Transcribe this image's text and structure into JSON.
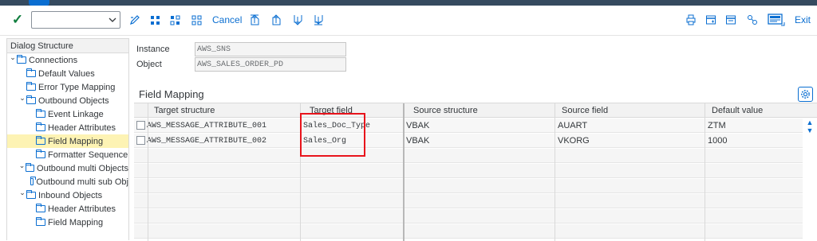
{
  "toolbar": {
    "command_value": "",
    "cancel_label": "Cancel",
    "exit_label": "Exit"
  },
  "dialog": {
    "title": "Dialog Structure",
    "items": [
      {
        "label": "Connections",
        "level": 0,
        "caret": true,
        "selected": false
      },
      {
        "label": "Default Values",
        "level": 1,
        "caret": false,
        "selected": false
      },
      {
        "label": "Error Type Mapping",
        "level": 1,
        "caret": false,
        "selected": false
      },
      {
        "label": "Outbound  Objects",
        "level": 1,
        "caret": true,
        "selected": false
      },
      {
        "label": "Event Linkage",
        "level": 2,
        "caret": false,
        "selected": false
      },
      {
        "label": "Header Attributes",
        "level": 2,
        "caret": false,
        "selected": false
      },
      {
        "label": "Field Mapping",
        "level": 2,
        "caret": false,
        "selected": true
      },
      {
        "label": "Formatter Sequence",
        "level": 2,
        "caret": false,
        "selected": false
      },
      {
        "label": "Outbound multi Objects",
        "level": 1,
        "caret": true,
        "selected": false
      },
      {
        "label": "Outbound multi sub Obj",
        "level": 2,
        "caret": false,
        "selected": false
      },
      {
        "label": "Inbound Objects",
        "level": 1,
        "caret": true,
        "selected": false
      },
      {
        "label": "Header Attributes",
        "level": 2,
        "caret": false,
        "selected": false
      },
      {
        "label": "Field Mapping",
        "level": 2,
        "caret": false,
        "selected": false
      }
    ]
  },
  "header_fields": {
    "instance_label": "Instance",
    "instance_value": "AWS_SNS",
    "object_label": "Object",
    "object_value": "AWS_SALES_ORDER_PD"
  },
  "field_mapping": {
    "title": "Field Mapping",
    "columns": [
      "Target structure",
      "Target field",
      "Source structure",
      "Source field",
      "Default value"
    ],
    "rows": [
      [
        "AWS_MESSAGE_ATTRIBUTE_001",
        "Sales_Doc_Type",
        "VBAK",
        "AUART",
        "ZTM"
      ],
      [
        "AWS_MESSAGE_ATTRIBUTE_002",
        "Sales_Org",
        "VBAK",
        "VKORG",
        "1000"
      ]
    ]
  },
  "colors": {
    "accent": "#0a6ed1",
    "shell": "#354a5f",
    "selected_row": "#fdf3b4",
    "highlight_box": "#e8141c",
    "check": "#107e3e"
  }
}
